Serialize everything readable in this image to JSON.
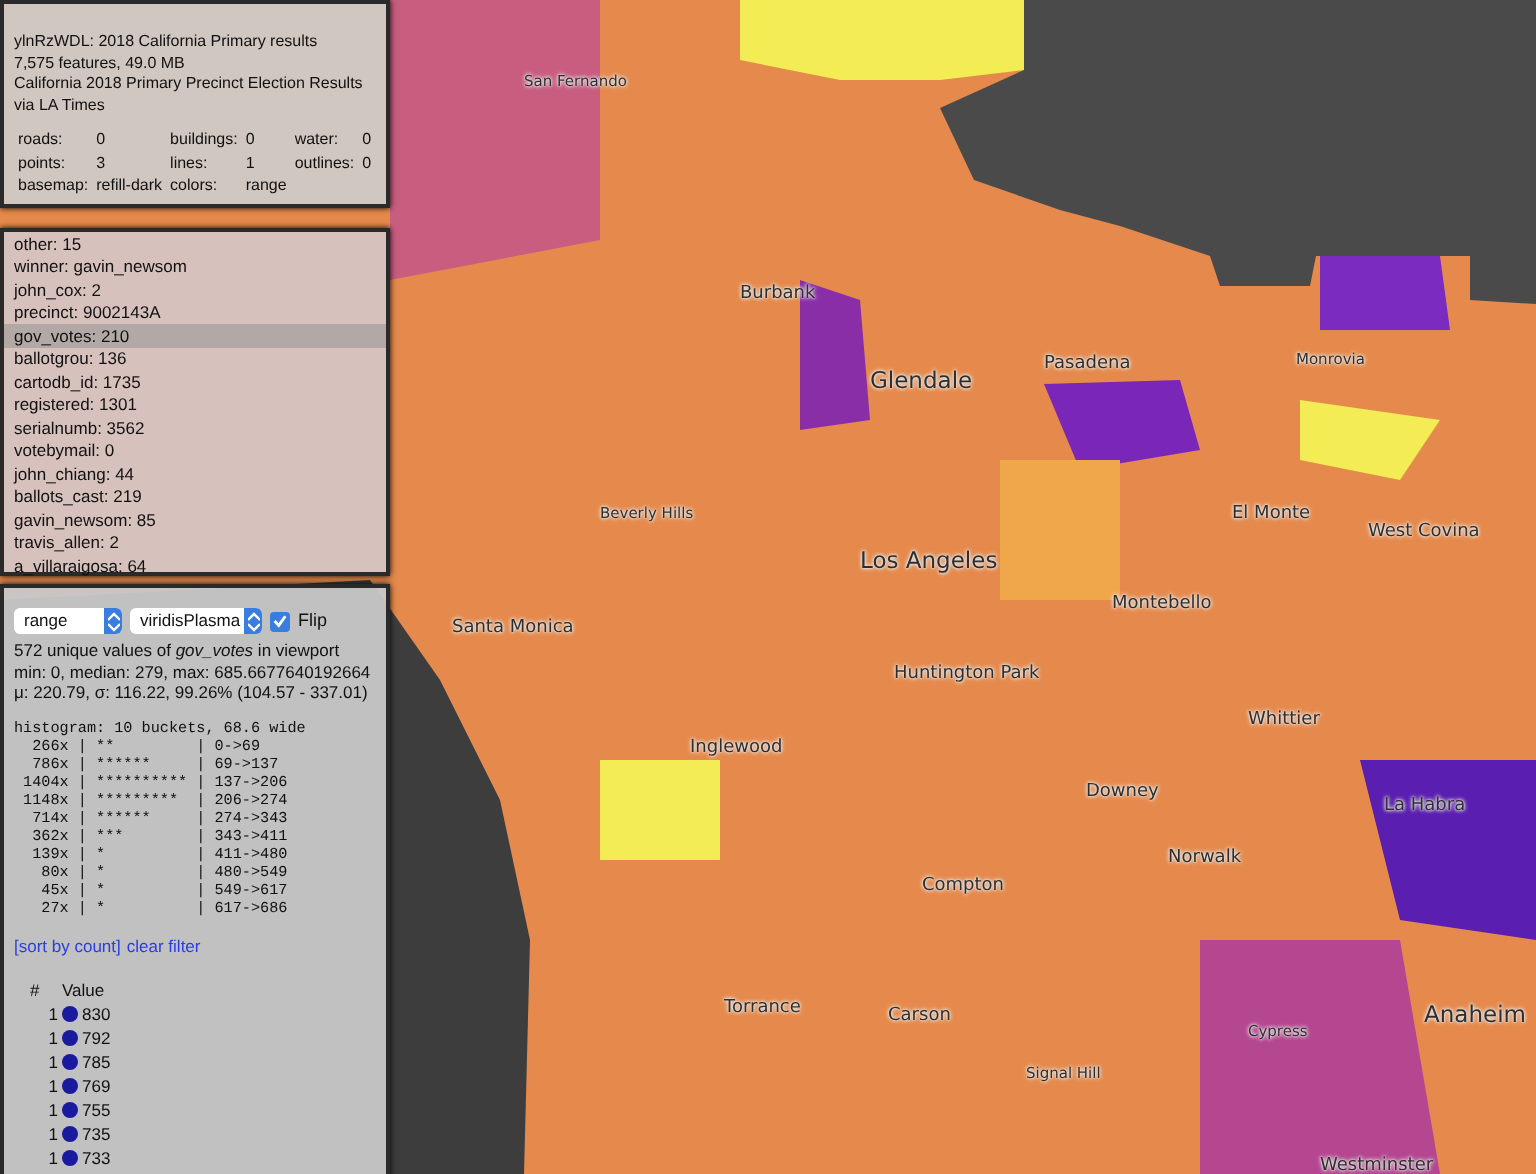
{
  "info_panel": {
    "title": "ylnRzWDL: 2018 California Primary results",
    "summary": "7,575 features, 49.0 MB",
    "description": "California 2018 Primary Precinct Election Results via LA Times",
    "stats": [
      {
        "label": "roads:",
        "value": "0"
      },
      {
        "label": "buildings:",
        "value": "0"
      },
      {
        "label": "water:",
        "value": "0"
      },
      {
        "label": "points:",
        "value": "3"
      },
      {
        "label": "lines:",
        "value": "1"
      },
      {
        "label": "outlines:",
        "value": "0"
      },
      {
        "label": "basemap:",
        "value": "refill-dark"
      },
      {
        "label": "colors:",
        "value": "range"
      }
    ]
  },
  "properties_panel": {
    "rows": [
      {
        "text": "other: 15",
        "selected": false
      },
      {
        "text": "winner: gavin_newsom",
        "selected": false
      },
      {
        "text": "john_cox: 2",
        "selected": false
      },
      {
        "text": "precinct: 9002143A",
        "selected": false
      },
      {
        "text": "gov_votes: 210",
        "selected": true
      },
      {
        "text": "ballotgrou: 136",
        "selected": false
      },
      {
        "text": "cartodb_id: 1735",
        "selected": false
      },
      {
        "text": "registered: 1301",
        "selected": false
      },
      {
        "text": "serialnumb: 3562",
        "selected": false
      },
      {
        "text": "votebymail: 0",
        "selected": false
      },
      {
        "text": "john_chiang: 44",
        "selected": false
      },
      {
        "text": "ballots_cast: 219",
        "selected": false
      },
      {
        "text": "gavin_newsom: 85",
        "selected": false
      },
      {
        "text": "travis_allen: 2",
        "selected": false
      },
      {
        "text": "a_villaraigosa: 64",
        "selected": false
      }
    ]
  },
  "color_panel": {
    "mode_select": "range",
    "palette_select": "viridisPlasma",
    "flip": {
      "label": "Flip",
      "checked": true
    },
    "summary": "572 unique values of *gov_votes* in viewport",
    "stats_line_1": "min: 0, median: 279, max: 685.6677640192664",
    "stats_line_2": "μ: 220.79, σ: 116.22, 99.26% (104.57 - 337.01)",
    "histogram_title": "histogram: 10 buckets, 68.6 wide",
    "histogram": [
      "  266x | **         | 0->69",
      "  786x | ******     | 69->137",
      " 1404x | ********** | 137->206",
      " 1148x | *********  | 206->274",
      "  714x | ******     | 274->343",
      "  362x | ***        | 343->411",
      "  139x | *          | 411->480",
      "   80x | *          | 480->549",
      "   45x | *          | 549->617",
      "   27x | *          | 617->686"
    ],
    "links": [
      "[sort by count]",
      "clear filter"
    ],
    "columns": [
      "#",
      "Value"
    ],
    "values": [
      {
        "count": "1",
        "value": "830"
      },
      {
        "count": "1",
        "value": "792"
      },
      {
        "count": "1",
        "value": "785"
      },
      {
        "count": "1",
        "value": "769"
      },
      {
        "count": "1",
        "value": "755"
      },
      {
        "count": "1",
        "value": "735"
      },
      {
        "count": "1",
        "value": "733"
      }
    ]
  },
  "map": {
    "labels": [
      {
        "text": "San Fernando",
        "kind": "small"
      },
      {
        "text": "Burbank",
        "kind": "medium"
      },
      {
        "text": "Glendale",
        "kind": "large"
      },
      {
        "text": "Pasadena",
        "kind": "medium"
      },
      {
        "text": "Monrovia",
        "kind": "small"
      },
      {
        "text": "Beverly Hills",
        "kind": "small"
      },
      {
        "text": "Los Angeles",
        "kind": "large"
      },
      {
        "text": "El Monte",
        "kind": "medium"
      },
      {
        "text": "West Covina",
        "kind": "medium"
      },
      {
        "text": "Santa Monica",
        "kind": "medium"
      },
      {
        "text": "Montebello",
        "kind": "medium"
      },
      {
        "text": "Huntington Park",
        "kind": "medium"
      },
      {
        "text": "Whittier",
        "kind": "medium"
      },
      {
        "text": "Inglewood",
        "kind": "medium"
      },
      {
        "text": "Downey",
        "kind": "medium"
      },
      {
        "text": "La Habra",
        "kind": "medium"
      },
      {
        "text": "Norwalk",
        "kind": "medium"
      },
      {
        "text": "Compton",
        "kind": "medium"
      },
      {
        "text": "Torrance",
        "kind": "medium"
      },
      {
        "text": "Carson",
        "kind": "medium"
      },
      {
        "text": "Anaheim",
        "kind": "large"
      },
      {
        "text": "Cypress",
        "kind": "small"
      },
      {
        "text": "Signal Hill",
        "kind": "small"
      },
      {
        "text": "Westminster",
        "kind": "medium"
      }
    ]
  }
}
